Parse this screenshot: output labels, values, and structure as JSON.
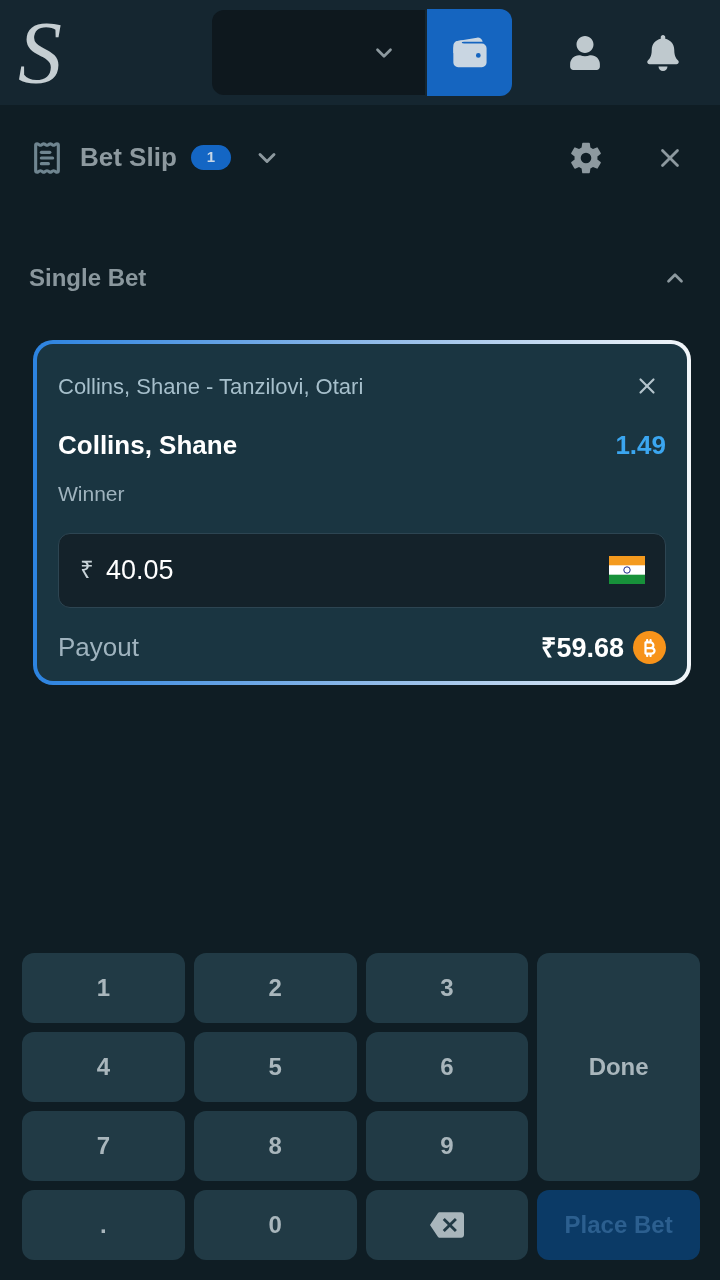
{
  "header": {
    "logo_text": "S"
  },
  "bet_slip": {
    "title": "Bet Slip",
    "count": "1"
  },
  "section": {
    "title": "Single Bet",
    "expanded": true
  },
  "bet": {
    "event": "Collins, Shane - Tanzilovi, Otari",
    "selection": "Collins, Shane",
    "odds": "1.49",
    "market": "Winner",
    "stake": {
      "currency": "₹",
      "value": "40.05"
    },
    "payout_label": "Payout",
    "payout": "₹59.68"
  },
  "keypad": [
    {
      "kind": "digit",
      "label": "1"
    },
    {
      "kind": "digit",
      "label": "2"
    },
    {
      "kind": "digit",
      "label": "3"
    },
    {
      "kind": "digit",
      "label": "4"
    },
    {
      "kind": "digit",
      "label": "5"
    },
    {
      "kind": "digit",
      "label": "6"
    },
    {
      "kind": "done",
      "label": "Done"
    },
    {
      "kind": "digit",
      "label": "7"
    },
    {
      "kind": "digit",
      "label": "8"
    },
    {
      "kind": "digit",
      "label": "9"
    },
    {
      "kind": "digit",
      "label": "."
    },
    {
      "kind": "digit",
      "label": "0"
    },
    {
      "kind": "backspace"
    },
    {
      "kind": "place",
      "label": "Place Bet",
      "disabled": true
    }
  ]
}
